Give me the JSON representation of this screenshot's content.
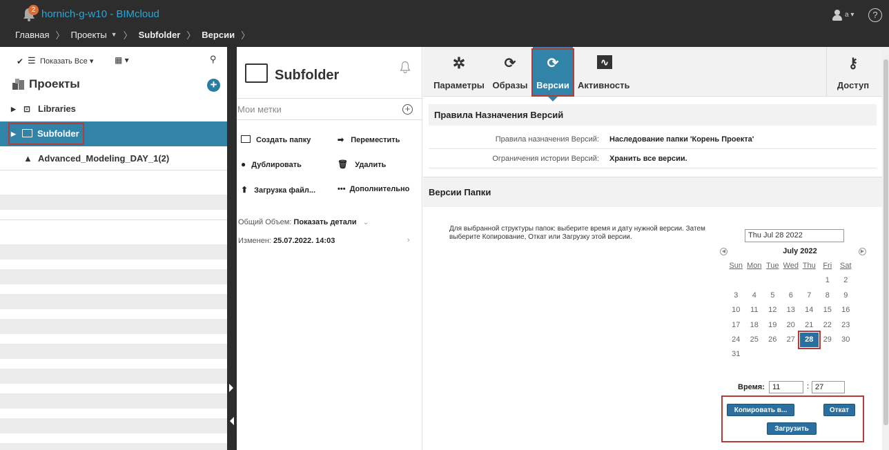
{
  "header": {
    "notification_count": "2",
    "app_title": "hornich-g-w10 - BIMcloud",
    "breadcrumbs": [
      "Главная",
      "Проекты",
      "Subfolder",
      "Версии"
    ],
    "user": "a",
    "help": "?"
  },
  "left": {
    "toolbar": {
      "show_all": "Показать Все"
    },
    "projects_title": "Проекты",
    "tree": [
      {
        "label": "Libraries"
      },
      {
        "label": "Subfolder",
        "selected": true
      },
      {
        "label": "Advanced_Modeling_DAY_1(2)"
      }
    ]
  },
  "middle": {
    "folder_title": "Subfolder",
    "tags_placeholder": "Мои метки",
    "actions": {
      "create_folder": "Создать папку",
      "move": "Переместить",
      "duplicate": "Дублировать",
      "delete": "Удалить",
      "upload": "Загрузка файл...",
      "more": "Дополнительно"
    },
    "total_label": "Общий Объем:",
    "total_value": "Показать детали",
    "modified_label": "Изменен:",
    "modified_value": "25.07.2022. 14:03"
  },
  "right": {
    "tabs": [
      {
        "label": "Параметры",
        "icon": "gear-icon"
      },
      {
        "label": "Образы",
        "icon": "snapshot-icon"
      },
      {
        "label": "Версии",
        "icon": "versions-icon",
        "active": true
      },
      {
        "label": "Активность",
        "icon": "activity-icon"
      }
    ],
    "access_label": "Доступ",
    "rules_section_title": "Правила Назначения Версий",
    "rules": [
      {
        "key": "Правила назначения Версий:",
        "value": "Наследование папки 'Корень Проекта'"
      },
      {
        "key": "Ограничения истории Версий:",
        "value": "Хранить все версии."
      }
    ],
    "versions_section_title": "Версии Папки",
    "description": "Для выбранной структуры папок: выберите время и дату нужной версии. Затем выберите Копирование, Откат или Загрузку этой версии.",
    "calendar": {
      "date_value": "Thu Jul 28 2022",
      "month": "July 2022",
      "weekdays": [
        "Sun",
        "Mon",
        "Tue",
        "Wed",
        "Thu",
        "Fri",
        "Sat"
      ],
      "leading_blanks": 5,
      "days_in_month": 31,
      "selected_day": 28
    },
    "time_label": "Время:",
    "time_hour": "11",
    "time_colon": ":",
    "time_minute": "27",
    "buttons": {
      "copy": "Копировать в...",
      "revert": "Откат",
      "download": "Загрузить"
    }
  }
}
